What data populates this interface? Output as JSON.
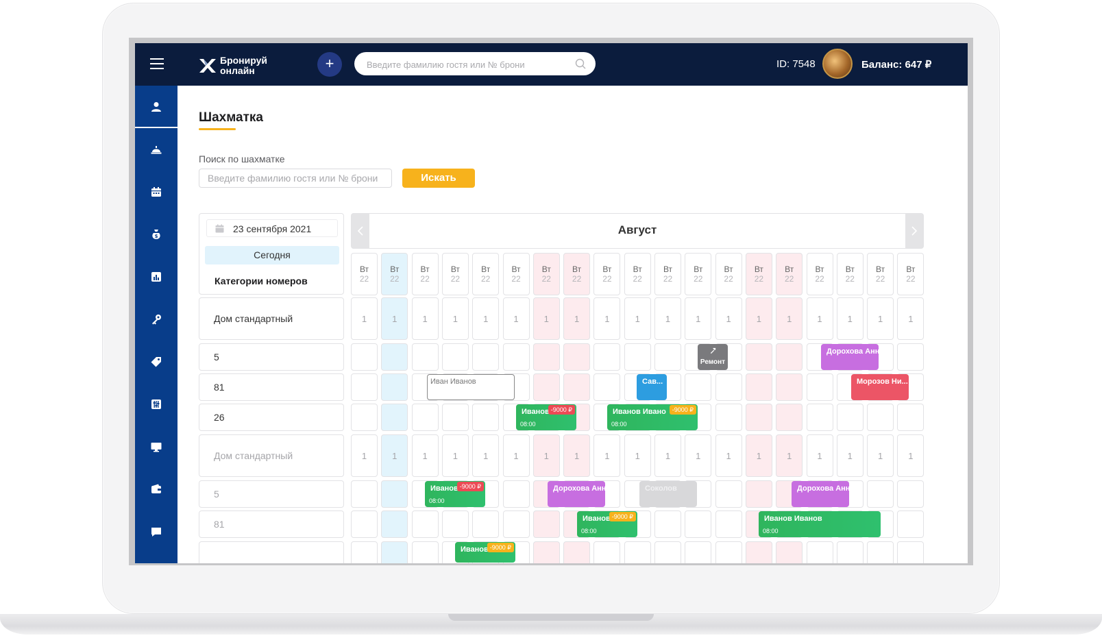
{
  "header": {
    "logo_line1": "Бронируй",
    "logo_line2": "онлайн",
    "search_placeholder": "Введите фамилию гостя или № брони",
    "id_label": "ID: 7548",
    "balance_label": "Баланс: 647 ₽"
  },
  "sidebar": {
    "items": [
      {
        "icon": "user-icon",
        "active": true
      },
      {
        "icon": "bell-service-icon"
      },
      {
        "icon": "calendar-icon"
      },
      {
        "icon": "money-bag-icon"
      },
      {
        "icon": "chart-icon"
      },
      {
        "icon": "key-icon"
      },
      {
        "icon": "tag-icon"
      },
      {
        "icon": "sliders-icon"
      },
      {
        "icon": "monitor-icon"
      },
      {
        "icon": "wallet-icon"
      },
      {
        "icon": "chat-icon"
      }
    ]
  },
  "page": {
    "title": "Шахматка",
    "search_label": "Поиск по шахматке",
    "search_placeholder": "Введите фамилию гостя или № брони",
    "search_button": "Искать",
    "date": "23 сентября 2021",
    "today_button": "Сегодня",
    "categories_label": "Категории номеров",
    "month": "Август"
  },
  "calendar": {
    "day_name": "Вт",
    "day_num": "22",
    "columns": 19,
    "today_col": 1,
    "weekend_cols": [
      6,
      7,
      13,
      14
    ],
    "rows": [
      {
        "label": "Дом стандартный",
        "type": "category",
        "dim": false
      },
      {
        "label": "5",
        "type": "room",
        "dim": false
      },
      {
        "label": "81",
        "type": "room",
        "dim": false
      },
      {
        "label": "26",
        "type": "room",
        "dim": false
      },
      {
        "label": "Дом стандартный",
        "type": "category",
        "dim": true
      },
      {
        "label": "5",
        "type": "room",
        "dim": true
      },
      {
        "label": "81",
        "type": "room",
        "dim": true
      },
      {
        "label": "",
        "type": "room",
        "dim": true
      }
    ],
    "category_count": "1",
    "bookings": [
      {
        "row": 1,
        "name": "Ремонт",
        "style": "repair"
      },
      {
        "row": 1,
        "name": "Дорохова Анна",
        "style": "purple"
      },
      {
        "row": 2,
        "name": "Иван Иванов",
        "style": "outline"
      },
      {
        "row": 2,
        "name": "Сав...",
        "style": "blue"
      },
      {
        "row": 2,
        "name": "Морозов Ни...",
        "style": "red"
      },
      {
        "row": 3,
        "name": "Иванов",
        "time": "08:00",
        "price": "-9000 ₽",
        "price_color": "#ec4a55"
      },
      {
        "row": 3,
        "name": "Иванов Ивано",
        "time": "08:00",
        "price": "-9000 ₽",
        "price_color": "#f7b21c"
      },
      {
        "row": 5,
        "name": "Иванов",
        "time": "08:00",
        "price": "-9000 ₽",
        "price_color": "#ec4a55"
      },
      {
        "row": 5,
        "name": "Дорохова Анна",
        "style": "purple"
      },
      {
        "row": 5,
        "name": "Соколов",
        "style": "gray"
      },
      {
        "row": 5,
        "name": "Дорохова Анна",
        "style": "purple"
      },
      {
        "row": 6,
        "name": "Иванов",
        "time": "08:00",
        "price": "-9000 ₽",
        "price_color": "#f7b21c"
      },
      {
        "row": 6,
        "name": "Иванов Иванов",
        "time": "08:00"
      },
      {
        "row": 7,
        "name": "Иванов",
        "price": "-9000 ₽",
        "price_color": "#f7b21c"
      }
    ]
  },
  "colors": {
    "topbar": "#0b1c3d",
    "sidebar": "#083d8a",
    "accent": "#f7b21c",
    "today_column": "#e2f4fc",
    "weekend_column": "#fdebee"
  }
}
